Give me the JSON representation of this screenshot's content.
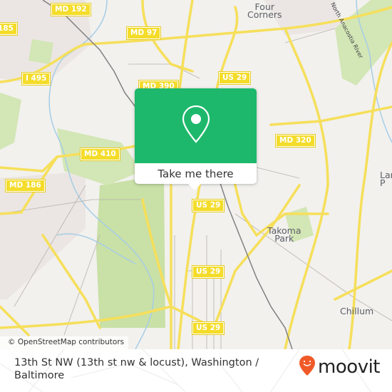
{
  "map": {
    "attribution": "© OpenStreetMap contributors",
    "road_shields": [
      {
        "label": "MD 192"
      },
      {
        "label": "185"
      },
      {
        "label": "MD 97"
      },
      {
        "label": "I 495"
      },
      {
        "label": "MD 390"
      },
      {
        "label": "US 29"
      },
      {
        "label": "MD 320"
      },
      {
        "label": "MD 410"
      },
      {
        "label": "MD 186"
      },
      {
        "label": "US 29"
      },
      {
        "label": "US 29"
      },
      {
        "label": "US 29"
      }
    ],
    "places": [
      {
        "label": "Four\nCorners"
      },
      {
        "label": "Takoma\nPark"
      },
      {
        "label": "Chillum"
      },
      {
        "label": "Lan\nP"
      }
    ],
    "water_labels": [
      {
        "label": "North Anacostia River"
      }
    ],
    "colors": {
      "land": "#f2f1ee",
      "park": "#c9e0a6",
      "road": "#f6df5a",
      "water": "#a6cde6",
      "rail": "#777777"
    }
  },
  "popup": {
    "icon": "map-pin-icon",
    "button_label": "Take me there",
    "color": "#1db86b"
  },
  "footer": {
    "title": "13th St NW (13th st nw & locust), Washington / Baltimore",
    "brand": "moovit",
    "brand_icon": "moovit-pin-icon",
    "brand_color": "#f05a28"
  }
}
